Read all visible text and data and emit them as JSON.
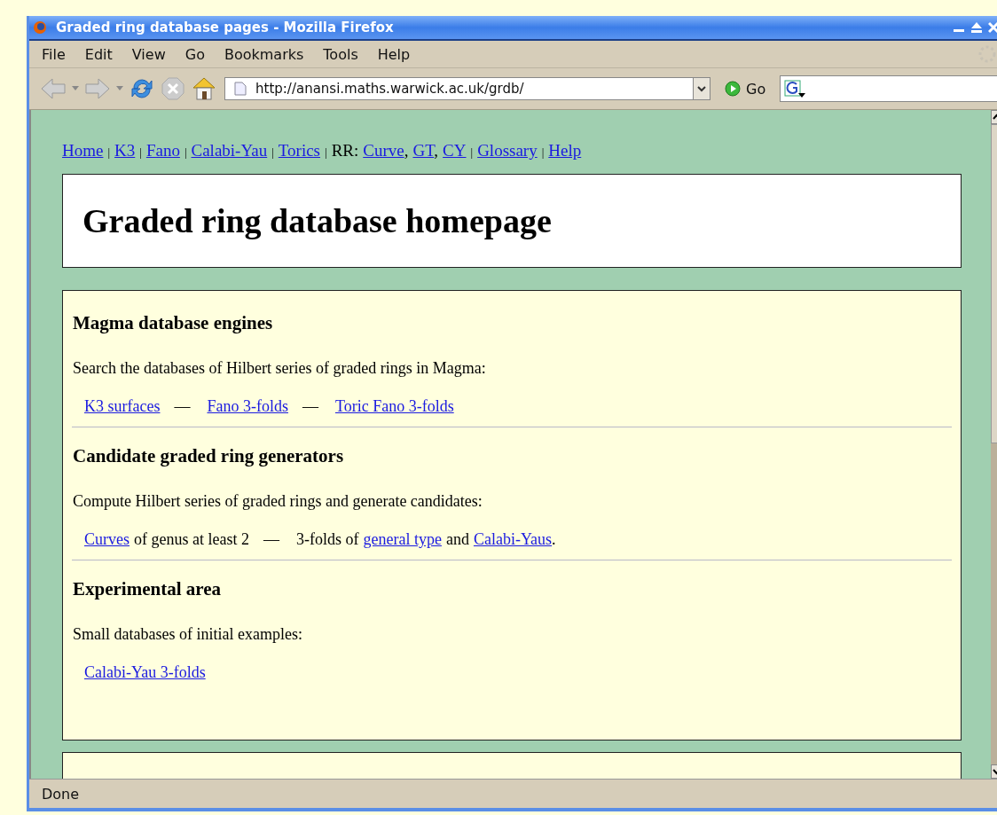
{
  "window": {
    "title": "Graded ring database pages - Mozilla Firefox"
  },
  "menu": [
    "File",
    "Edit",
    "View",
    "Go",
    "Bookmarks",
    "Tools",
    "Help"
  ],
  "toolbar": {
    "url": "http://anansi.maths.warwick.ac.uk/grdb/",
    "go": "Go"
  },
  "nav": [
    {
      "kind": "link",
      "text": "Home"
    },
    {
      "kind": "sep",
      "text": "|"
    },
    {
      "kind": "link",
      "text": "K3"
    },
    {
      "kind": "sep",
      "text": "|"
    },
    {
      "kind": "link",
      "text": "Fano"
    },
    {
      "kind": "sep",
      "text": "|"
    },
    {
      "kind": "link",
      "text": "Calabi-Yau"
    },
    {
      "kind": "sep",
      "text": "|"
    },
    {
      "kind": "link",
      "text": "Torics"
    },
    {
      "kind": "sep",
      "text": "|"
    },
    {
      "kind": "text",
      "text": "RR:"
    },
    {
      "kind": "link",
      "text": "Curve"
    },
    {
      "kind": "punct",
      "text": ","
    },
    {
      "kind": "link",
      "text": "GT"
    },
    {
      "kind": "punct",
      "text": ","
    },
    {
      "kind": "link",
      "text": "CY"
    },
    {
      "kind": "sep",
      "text": "|"
    },
    {
      "kind": "link",
      "text": "Glossary"
    },
    {
      "kind": "sep",
      "text": "|"
    },
    {
      "kind": "link",
      "text": "Help"
    }
  ],
  "page_title": "Graded ring database homepage",
  "sections": [
    {
      "heading": "Magma database engines",
      "description": "Search the databases of Hilbert series of graded rings in Magma:",
      "parts": [
        {
          "kind": "link",
          "text": "K3 surfaces"
        },
        {
          "kind": "dash",
          "text": "—"
        },
        {
          "kind": "link",
          "text": "Fano 3-folds"
        },
        {
          "kind": "dash",
          "text": "—"
        },
        {
          "kind": "link",
          "text": "Toric Fano 3-folds"
        }
      ]
    },
    {
      "heading": "Candidate graded ring generators",
      "description": "Compute Hilbert series of graded rings and generate candidates:",
      "parts": [
        {
          "kind": "link",
          "text": "Curves"
        },
        {
          "kind": "text",
          "text": "of genus at least 2"
        },
        {
          "kind": "dash",
          "text": "—"
        },
        {
          "kind": "text",
          "text": "3-folds of"
        },
        {
          "kind": "link",
          "text": "general type"
        },
        {
          "kind": "text",
          "text": "and"
        },
        {
          "kind": "link",
          "text": "Calabi-Yaus"
        },
        {
          "kind": "punct",
          "text": "."
        }
      ]
    },
    {
      "heading": "Experimental area",
      "description": "Small databases of initial examples:",
      "parts": [
        {
          "kind": "link",
          "text": "Calabi-Yau 3-folds"
        }
      ]
    }
  ],
  "status_bar": "Done"
}
